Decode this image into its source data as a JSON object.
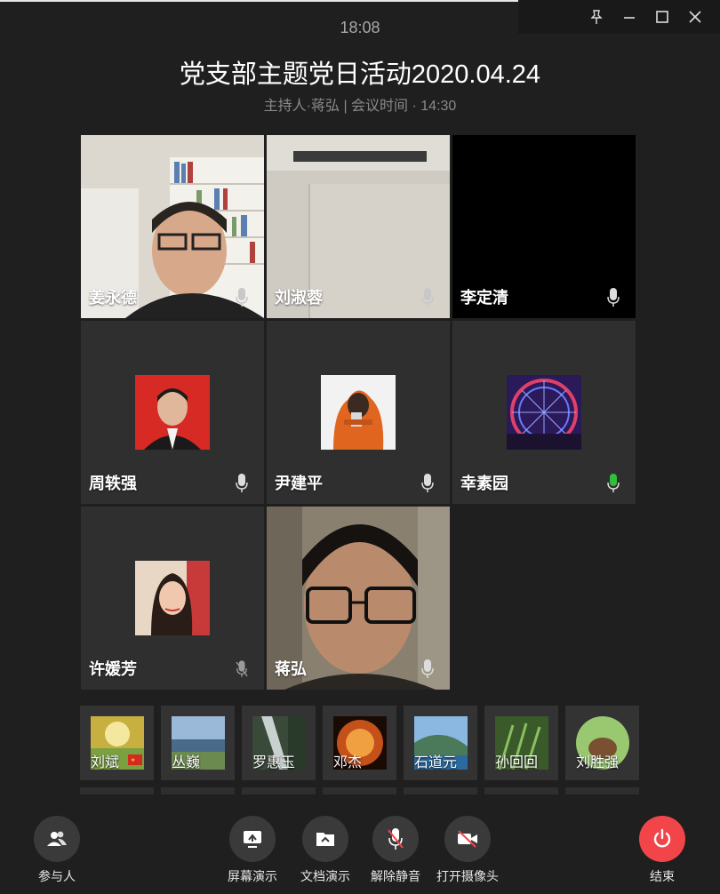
{
  "window": {
    "clock": "18:08",
    "controls": [
      "pin-icon",
      "minimize-icon",
      "maximize-icon",
      "close-icon"
    ]
  },
  "meeting": {
    "title": "党支部主题党日活动2020.04.24",
    "subtitle": "主持人·蒋弘 | 会议时间 · 14:30"
  },
  "participants": [
    {
      "name": "姜永德",
      "mic": "muted-gray"
    },
    {
      "name": "刘淑蓉",
      "mic": "muted-gray"
    },
    {
      "name": "李定清",
      "mic": "normal"
    },
    {
      "name": "周轶强",
      "mic": "normal"
    },
    {
      "name": "尹建平",
      "mic": "normal"
    },
    {
      "name": "幸素园",
      "mic": "speaking-green"
    },
    {
      "name": "许媛芳",
      "mic": "muted"
    },
    {
      "name": "蒋弘",
      "mic": "normal"
    }
  ],
  "strip": [
    {
      "name": "刘斌"
    },
    {
      "name": "丛巍"
    },
    {
      "name": "罗惠玉"
    },
    {
      "name": "邓杰"
    },
    {
      "name": "石道元"
    },
    {
      "name": "孙回回"
    },
    {
      "name": "刘胜强"
    }
  ],
  "controls": {
    "participants": "参与人",
    "screen_share": "屏幕演示",
    "doc_share": "文档演示",
    "unmute": "解除静音",
    "camera": "打开摄像头",
    "end": "结束"
  },
  "colors": {
    "background": "#1f1f1f",
    "tile": "#2f2f2f",
    "end_button": "#f2454a",
    "speaking": "#2fbf3a"
  }
}
